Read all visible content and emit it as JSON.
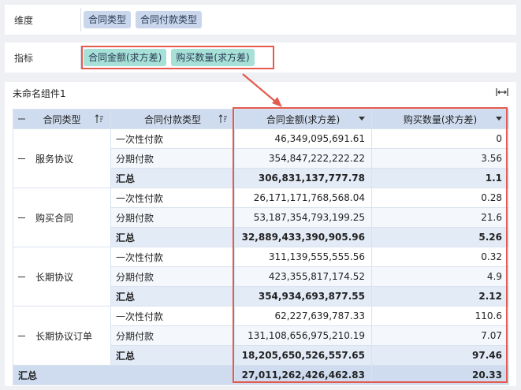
{
  "shelves": {
    "dimension": {
      "label": "维度",
      "chips": [
        "合同类型",
        "合同付款类型"
      ]
    },
    "metric": {
      "label": "指标",
      "chips": [
        "合同金额(求方差)",
        "购买数量(求方差)"
      ]
    }
  },
  "component": {
    "title": "未命名组件1",
    "columns": [
      "合同类型",
      "合同付款类型",
      "合同金额(求方差)",
      "购买数量(求方差)"
    ],
    "groups": [
      {
        "name": "服务协议",
        "rows": [
          {
            "type": "一次性付款",
            "amount": "46,349,095,691.61",
            "qty": "0"
          },
          {
            "type": "分期付款",
            "amount": "354,847,222,222.22",
            "qty": "3.56"
          }
        ],
        "subtotal": {
          "label": "汇总",
          "amount": "306,831,137,777.78",
          "qty": "1.1"
        }
      },
      {
        "name": "购买合同",
        "rows": [
          {
            "type": "一次性付款",
            "amount": "26,171,171,768,568.04",
            "qty": "0.28"
          },
          {
            "type": "分期付款",
            "amount": "53,187,354,793,199.25",
            "qty": "21.6"
          }
        ],
        "subtotal": {
          "label": "汇总",
          "amount": "32,889,433,390,905.96",
          "qty": "5.26"
        }
      },
      {
        "name": "长期协议",
        "rows": [
          {
            "type": "一次性付款",
            "amount": "311,139,555,555.56",
            "qty": "0.32"
          },
          {
            "type": "分期付款",
            "amount": "423,355,817,174.52",
            "qty": "4.9"
          }
        ],
        "subtotal": {
          "label": "汇总",
          "amount": "354,934,693,877.55",
          "qty": "2.12"
        }
      },
      {
        "name": "长期协议订单",
        "rows": [
          {
            "type": "一次性付款",
            "amount": "62,227,639,787.33",
            "qty": "110.6"
          },
          {
            "type": "分期付款",
            "amount": "131,108,656,975,210.19",
            "qty": "7.07"
          }
        ],
        "subtotal": {
          "label": "汇总",
          "amount": "18,205,650,526,557.65",
          "qty": "97.46"
        }
      }
    ],
    "grand_total": {
      "label": "汇总",
      "amount": "27,011,262,426,462.83",
      "qty": "20.33"
    }
  },
  "colors": {
    "highlight": "#e55a4e",
    "header": "#cfdcf0",
    "dim_chip": "#c9d6ec",
    "metric_chip": "#a6e0d6"
  },
  "icons": [
    "collapse-icon",
    "sort-icon",
    "caret-down-icon",
    "expand-width-icon",
    "arrow-annotation"
  ]
}
